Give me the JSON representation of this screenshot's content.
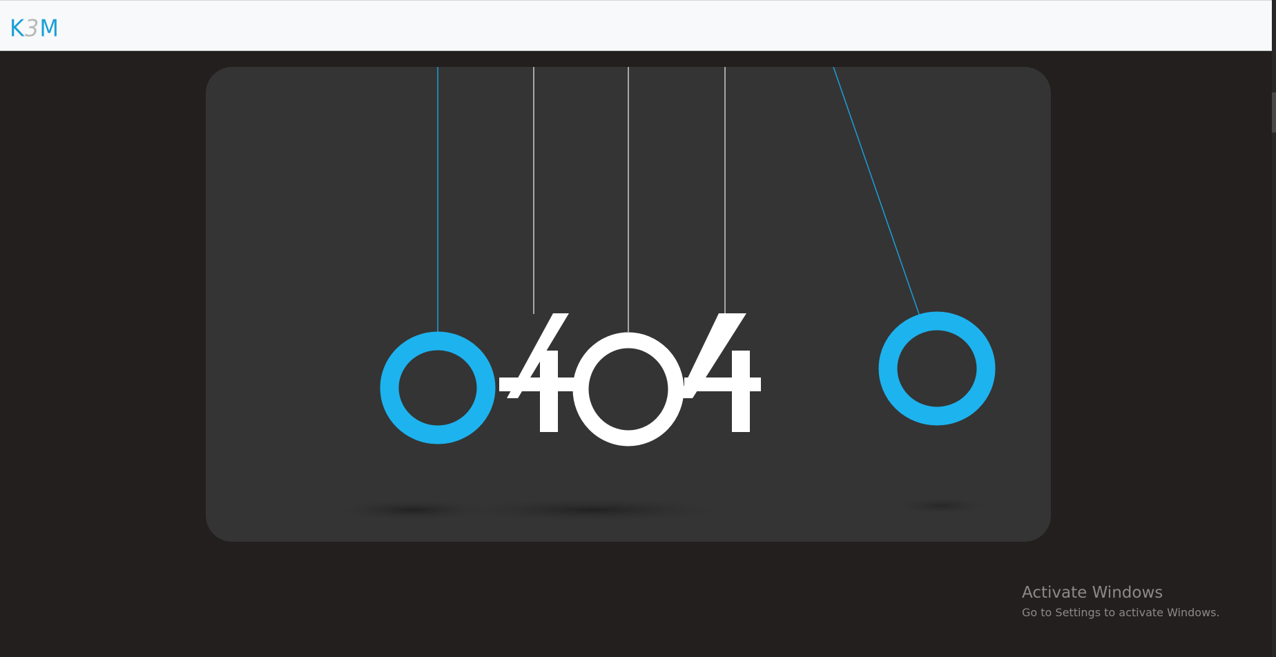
{
  "navbar": {
    "brand_letter_1": "K",
    "brand_letter_2": "3",
    "brand_letter_3": "M",
    "brand_primary_color": "#1b9fd8",
    "brand_secondary_color": "#b9b9b9"
  },
  "error": {
    "digits": [
      "4",
      "0",
      "4"
    ],
    "accent_color": "#1db3ee",
    "text_color": "#ffffff"
  },
  "watermark": {
    "title": "Activate Windows",
    "subtitle": "Go to Settings to activate Windows."
  }
}
